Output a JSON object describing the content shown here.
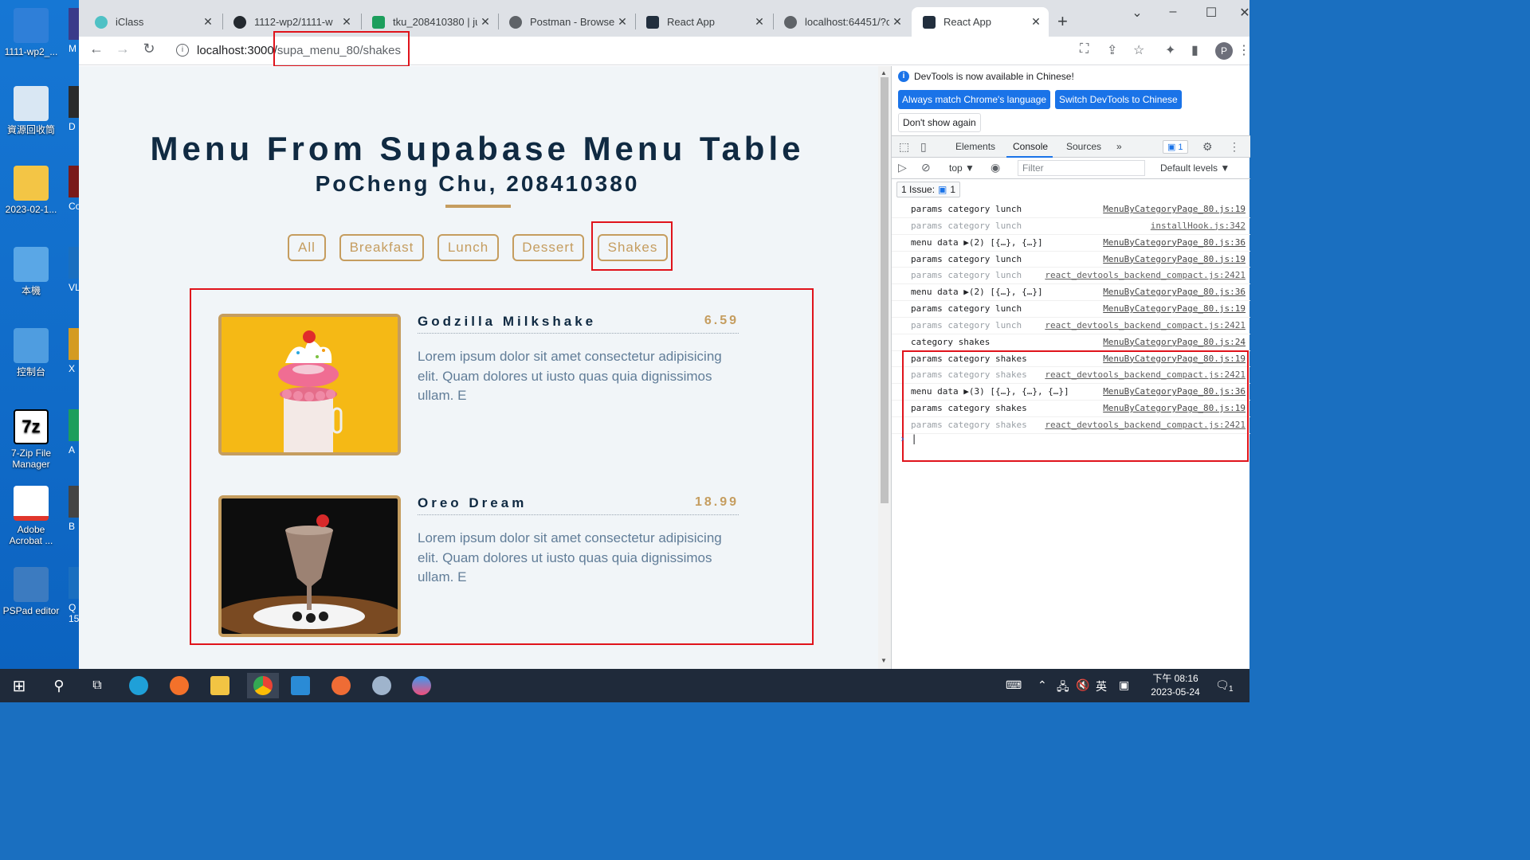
{
  "desktop": {
    "icons": [
      {
        "label": "1111-wp2_...",
        "color": "#2f7fd8"
      },
      {
        "label": "資源回收筒",
        "color": "#d9e7f3"
      },
      {
        "label": "2023-02-1...",
        "color": "#f3c545"
      },
      {
        "label": "本機",
        "color": "#5aa7e6"
      },
      {
        "label": "控制台",
        "color": "#4f9de0"
      },
      {
        "label": "7-Zip File Manager",
        "color": "#ffffff"
      },
      {
        "label": "Adobe Acrobat ...",
        "color": "#e0362c"
      },
      {
        "label": "PSPad editor",
        "color": "#3c7bc0"
      }
    ],
    "partial_labels": [
      "M",
      "D",
      "Co",
      "VL",
      "X",
      "A",
      "B",
      "Q 15."
    ]
  },
  "browser": {
    "tabs": [
      {
        "label": "iClass",
        "color": "#4fc1c5"
      },
      {
        "label": "1112-wp2/1111-w",
        "color": "#24292f"
      },
      {
        "label": "tku_208410380 | ju",
        "color": "#1c9e5c"
      },
      {
        "label": "Postman - Browser",
        "color": "#5f6368"
      },
      {
        "label": "React App",
        "color": "#222f3e"
      },
      {
        "label": "localhost:64451/?c",
        "color": "#5f6368"
      },
      {
        "label": "React App",
        "color": "#222f3e"
      }
    ],
    "new_tab_label": "+",
    "url_host": "localhost:3000/",
    "url_path": "supa_menu_80/shakes",
    "profile_initial": "P"
  },
  "page": {
    "title": "Menu From Supabase Menu Table",
    "subtitle": "PoCheng Chu, 208410380",
    "filters": [
      "All",
      "Breakfast",
      "Lunch",
      "Dessert",
      "Shakes"
    ],
    "items": [
      {
        "name": "Godzilla Milkshake",
        "price": "6.59",
        "desc": "Lorem ipsum dolor sit amet consectetur adipisicing elit. Quam dolores ut iusto quas quia dignissimos ullam. E"
      },
      {
        "name": "Oreo Dream",
        "price": "18.99",
        "desc": "Lorem ipsum dolor sit amet consectetur adipisicing elit. Quam dolores ut iusto quas quia dignissimos ullam. E"
      }
    ],
    "accent_color": "#c59d5f",
    "highlight_color": "#e0131b"
  },
  "devtools": {
    "notice": "DevTools is now available in Chinese!",
    "btn_match": "Always match Chrome's language",
    "btn_switch": "Switch DevTools to Chinese",
    "btn_dont_show": "Don't show again",
    "tabs": [
      "Elements",
      "Console",
      "Sources"
    ],
    "active_tab": "Console",
    "more_tabs": "»",
    "issues_badge": "1",
    "context": "top ▼",
    "filter_placeholder": "Filter",
    "levels": "Default levels ▼",
    "issue_label": "1 Issue:",
    "issue_count": "1",
    "console": [
      {
        "msg": "params category lunch",
        "src": "MenuByCategoryPage_80.js:19",
        "dim": false
      },
      {
        "msg": "params category lunch",
        "src": "installHook.js:342",
        "dim": true
      },
      {
        "msg": "menu data ▶(2) [{…}, {…}]",
        "src": "MenuByCategoryPage_80.js:36",
        "dim": false
      },
      {
        "msg": "params category lunch",
        "src": "MenuByCategoryPage_80.js:19",
        "dim": false
      },
      {
        "msg": "params category lunch",
        "src": "react_devtools_backend_compact.js:2421",
        "dim": true
      },
      {
        "msg": "menu data ▶(2) [{…}, {…}]",
        "src": "MenuByCategoryPage_80.js:36",
        "dim": false
      },
      {
        "msg": "params category lunch",
        "src": "MenuByCategoryPage_80.js:19",
        "dim": false
      },
      {
        "msg": "params category lunch",
        "src": "react_devtools_backend_compact.js:2421",
        "dim": true
      },
      {
        "msg": "category shakes",
        "src": "MenuByCategoryPage_80.js:24",
        "dim": false
      },
      {
        "msg": "params category shakes",
        "src": "MenuByCategoryPage_80.js:19",
        "dim": false
      },
      {
        "msg": "params category shakes",
        "src": "react_devtools_backend_compact.js:2421",
        "dim": true
      },
      {
        "msg": "menu data ▶(3) [{…}, {…}, {…}]",
        "src": "MenuByCategoryPage_80.js:36",
        "dim": false
      },
      {
        "msg": "params category shakes",
        "src": "MenuByCategoryPage_80.js:19",
        "dim": false
      },
      {
        "msg": "params category shakes",
        "src": "react_devtools_backend_compact.js:2421",
        "dim": true
      }
    ],
    "prompt": "›"
  },
  "taskbar": {
    "time": "下午 08:16",
    "date": "2023-05-24",
    "ime": "英",
    "notification_count": "1"
  }
}
